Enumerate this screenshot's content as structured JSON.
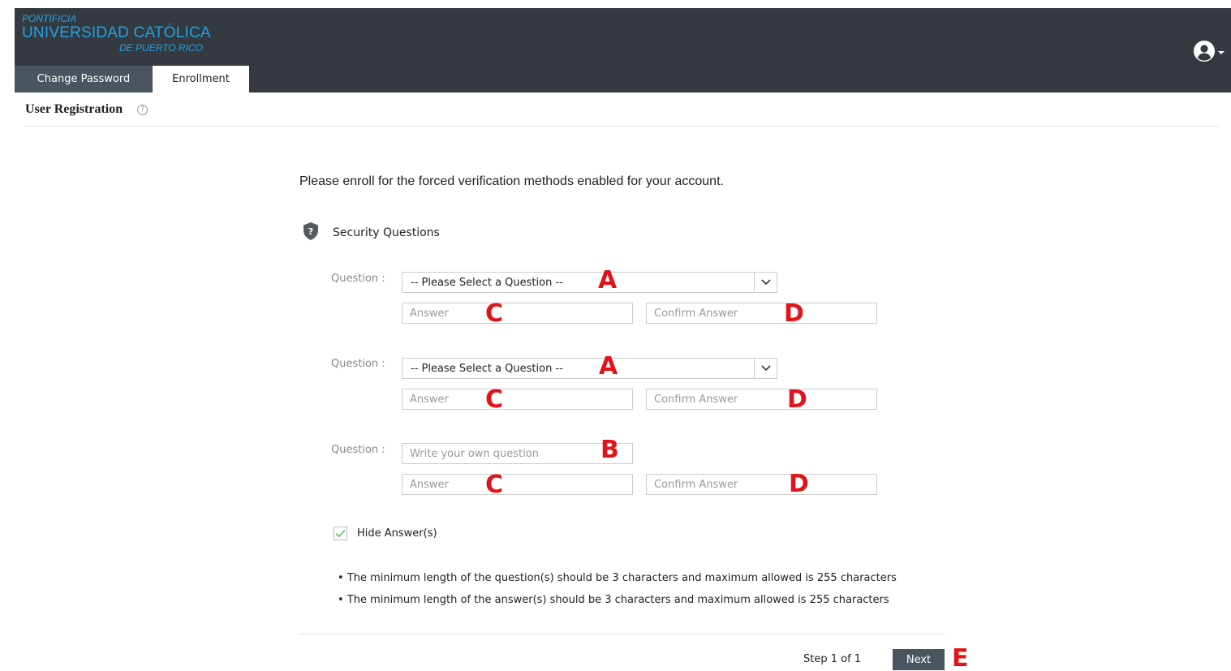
{
  "header": {
    "logo_line1": "PONTIFICIA",
    "logo_line2": "UNIVERSIDAD CATÓLICA",
    "logo_line3": "DE PUERTO RICO",
    "user_icon": "user-circle-icon"
  },
  "tabs": [
    {
      "label": "Change Password",
      "active": false
    },
    {
      "label": "Enrollment",
      "active": true
    }
  ],
  "page": {
    "title": "User Registration",
    "help_icon": "question-circle-icon",
    "intro": "Please enroll for the forced verification methods enabled for your account."
  },
  "section": {
    "icon": "shield-question-icon",
    "label": "Security Questions"
  },
  "questions": [
    {
      "label": "Question :",
      "select_value": "-- Please Select a Question --",
      "answer_placeholder": "Answer",
      "confirm_placeholder": "Confirm Answer",
      "markers": {
        "question": "A",
        "answer": "C",
        "confirm": "D"
      }
    },
    {
      "label": "Question :",
      "select_value": "-- Please Select a Question --",
      "answer_placeholder": "Answer",
      "confirm_placeholder": "Confirm Answer",
      "markers": {
        "question": "A",
        "answer": "C",
        "confirm": "D"
      }
    },
    {
      "label": "Question :",
      "own_placeholder": "Write your own question",
      "answer_placeholder": "Answer",
      "confirm_placeholder": "Confirm Answer",
      "markers": {
        "question": "B",
        "answer": "C",
        "confirm": "D"
      }
    }
  ],
  "hide_answers": {
    "label": "Hide Answer(s)",
    "checked": true
  },
  "rules": [
    "• The minimum length of the question(s) should be 3 characters and maximum allowed is 255 characters",
    "• The minimum length of the answer(s) should be 3 characters and maximum allowed is 255 characters"
  ],
  "footer": {
    "step": "Step 1 of 1",
    "next_label": "Next",
    "next_marker": "E"
  },
  "colors": {
    "header_bg": "#343a40",
    "logo": "#1fa2e6",
    "tab_inactive": "#4a545e",
    "marker": "#e0151b",
    "check": "#5cb85c"
  }
}
